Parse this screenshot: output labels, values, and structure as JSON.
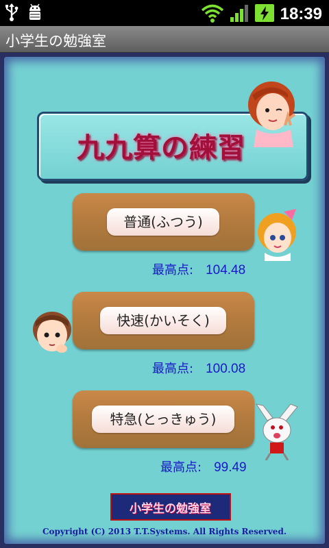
{
  "status_bar": {
    "time": "18:39",
    "icons": [
      "usb-icon",
      "android-debug-icon",
      "wifi-icon",
      "signal-icon",
      "battery-charging-icon"
    ]
  },
  "app": {
    "title": "小学生の勉強室"
  },
  "main": {
    "heading": "九九算の練習",
    "modes": [
      {
        "label": "普通(ふつう)",
        "score_label": "最高点:",
        "score": "104.48"
      },
      {
        "label": "快速(かいそく)",
        "score_label": "最高点:",
        "score": "100.08"
      },
      {
        "label": "特急(とっきゅう)",
        "score_label": "最高点:",
        "score": "99.49"
      }
    ],
    "banner": "小学生の勉強室",
    "copyright": "Copyright (C) 2013 T.T.Systems. All Rights Reserved."
  },
  "colors": {
    "panel": "#74d1d1",
    "button": "#b27a3e",
    "score_text": "#1818c8",
    "heading": "#a0103a"
  }
}
